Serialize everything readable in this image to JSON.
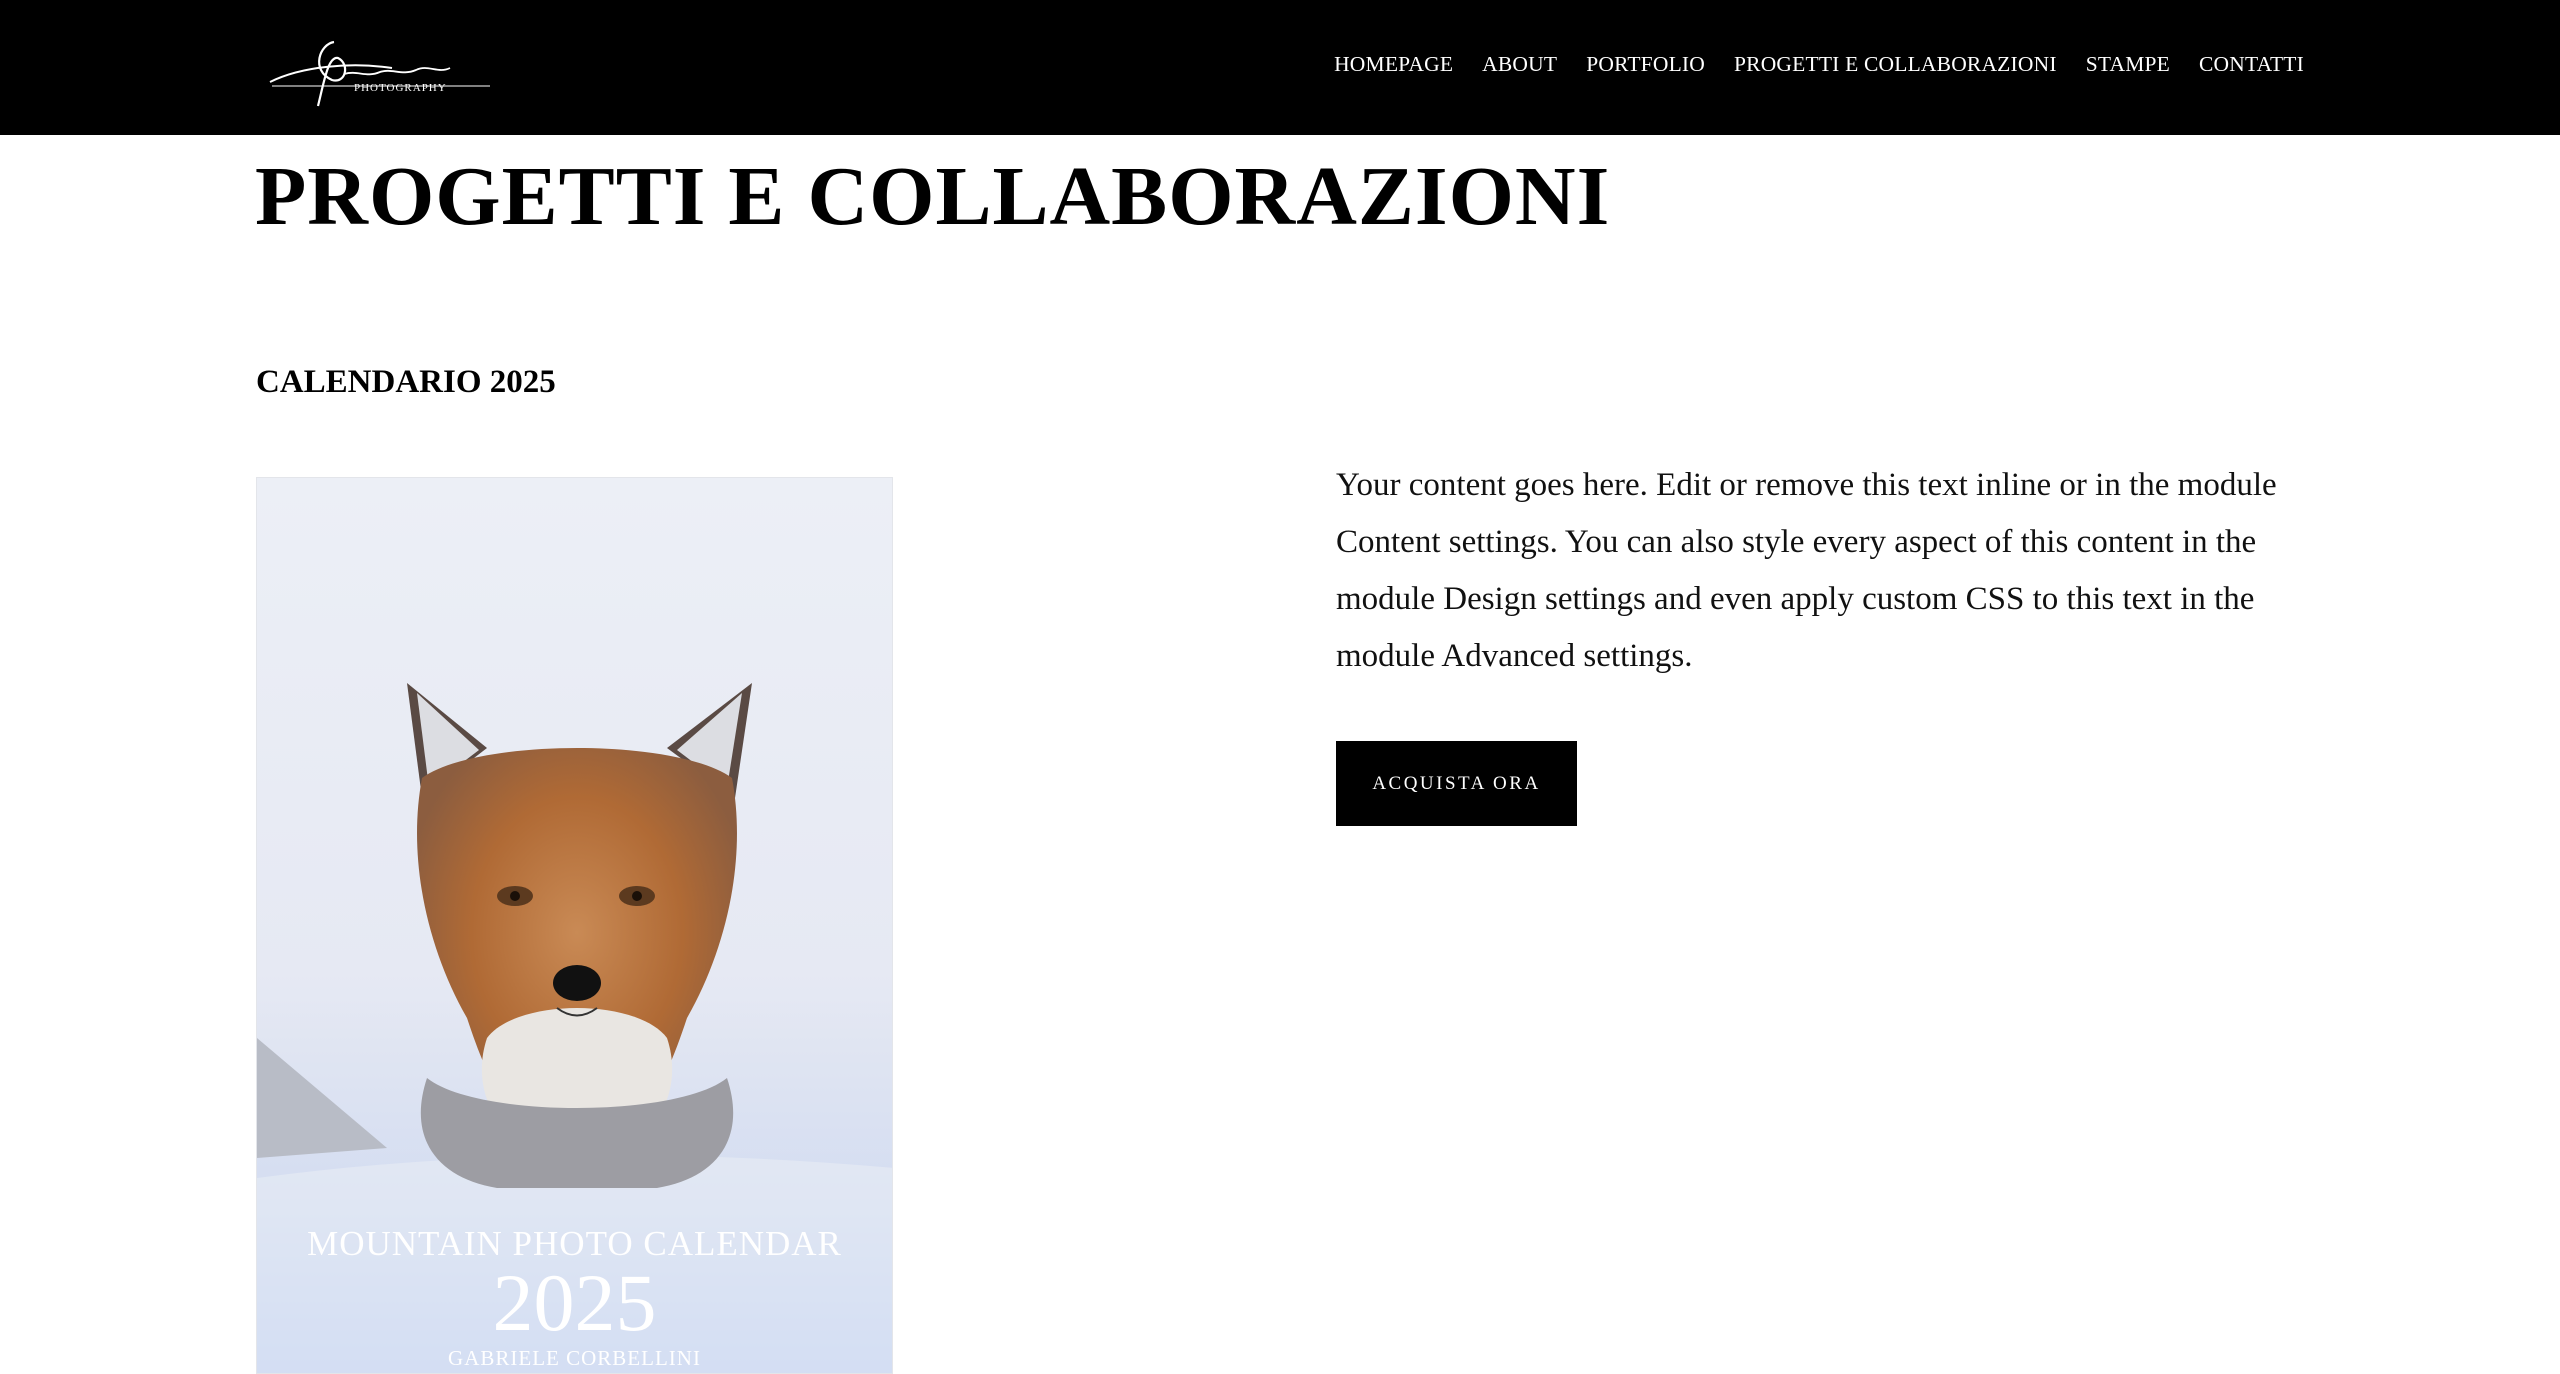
{
  "header": {
    "logo": {
      "signature": "G.Corbellini",
      "subtitle": "PHOTOGRAPHY"
    },
    "nav": [
      "HOMEPAGE",
      "ABOUT",
      "PORTFOLIO",
      "PROGETTI E COLLABORAZIONI",
      "STAMPE",
      "CONTATTI"
    ]
  },
  "main": {
    "title": "PROGETTI E COLLABORAZIONI",
    "section_title": "CALENDARIO 2025",
    "calendar": {
      "caption_title": "MOUNTAIN PHOTO CALENDAR",
      "caption_year": "2025",
      "caption_author": "GABRIELE CORBELLINI"
    },
    "content_text": "Your content goes here. Edit or remove this text inline or in the module Content settings. You can also style every aspect of this content in the module Design settings and even apply custom CSS to this text in the module Advanced settings.",
    "button_label": "ACQUISTA ORA"
  },
  "colors": {
    "header_bg": "#000000",
    "page_bg": "#ffffff",
    "button_bg": "#000000"
  }
}
